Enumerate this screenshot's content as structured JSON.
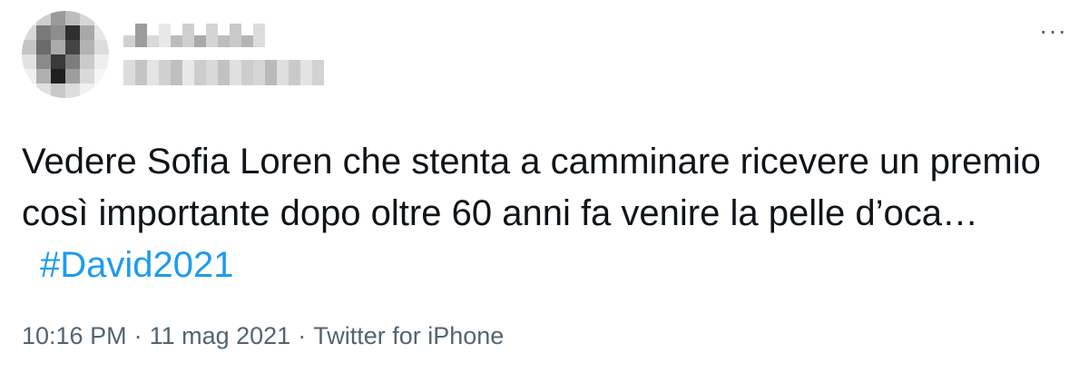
{
  "tweet": {
    "text_body": "Vedere Sofia Loren che stenta a camminare ricevere un premio così importante dopo oltre 60 anni fa venire la pelle d’oca…",
    "hashtag": "#David2021",
    "time": "10:16 PM",
    "date": "11 mag 2021",
    "source": "Twitter for iPhone",
    "separator": "·",
    "more_label": "···"
  },
  "colors": {
    "text": "#0f1419",
    "secondary": "#536471",
    "link": "#1d9bf0"
  },
  "icons": {
    "more": "more-horizontal-icon"
  }
}
